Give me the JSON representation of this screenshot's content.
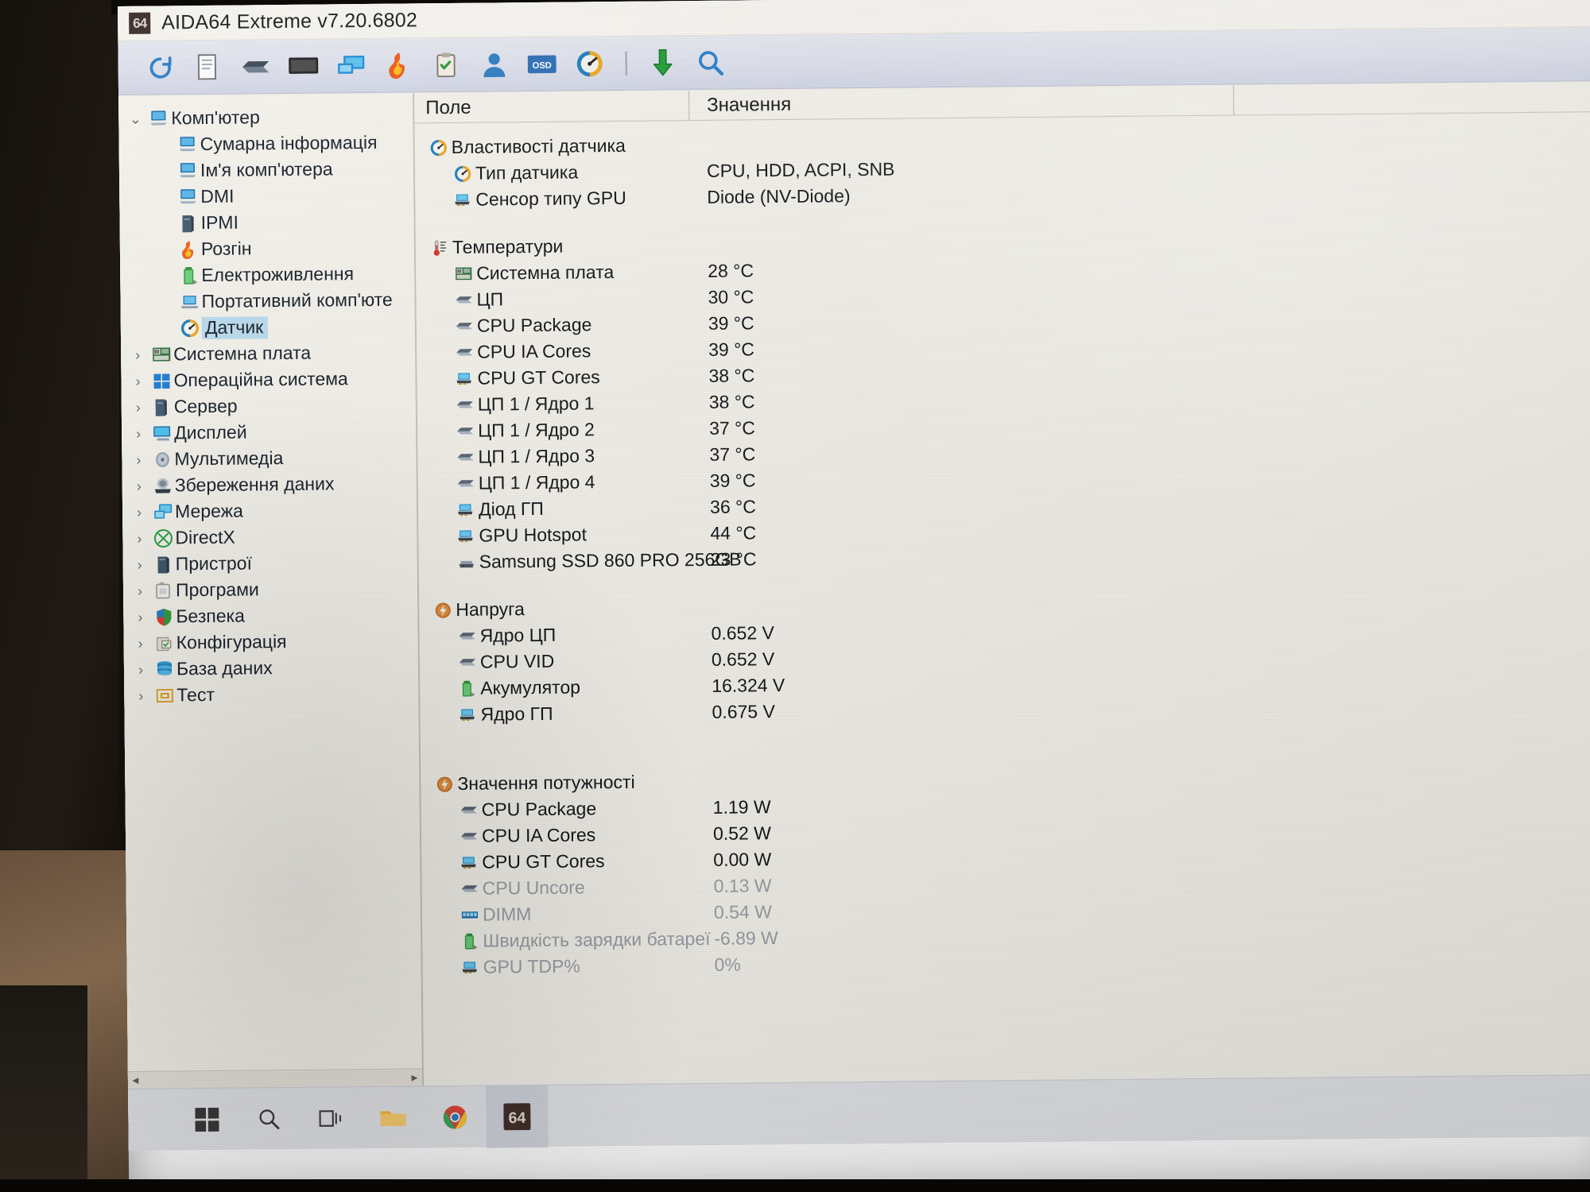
{
  "window": {
    "title": "AIDA64 Extreme v7.20.6802",
    "app_badge": "64"
  },
  "toolbar": {
    "buttons": [
      {
        "name": "refresh-icon",
        "tooltip": "Refresh"
      },
      {
        "name": "report-icon",
        "tooltip": "Report"
      },
      {
        "name": "motherboard-icon",
        "tooltip": "Motherboard"
      },
      {
        "name": "monitor-icon",
        "tooltip": "Display"
      },
      {
        "name": "network-icon",
        "tooltip": "Network"
      },
      {
        "name": "overclock-icon",
        "tooltip": "Overclock"
      },
      {
        "name": "benchmark-icon",
        "tooltip": "Benchmark"
      },
      {
        "name": "user-icon",
        "tooltip": "User"
      },
      {
        "name": "osd-icon",
        "tooltip": "OSD Panel"
      },
      {
        "name": "sensor-icon",
        "tooltip": "Sensor"
      },
      {
        "name": "download-icon",
        "tooltip": "Download"
      },
      {
        "name": "search-icon",
        "tooltip": "Search"
      }
    ],
    "osd_label": "OSD"
  },
  "sidebar": {
    "items": [
      {
        "label": "Комп'ютер",
        "depth": 0,
        "twisty": "open",
        "icon": "computer-icon",
        "selected": false
      },
      {
        "label": "Сумарна інформація",
        "depth": 1,
        "twisty": "none",
        "icon": "computer-icon",
        "selected": false
      },
      {
        "label": "Ім'я комп'ютера",
        "depth": 1,
        "twisty": "none",
        "icon": "computer-icon",
        "selected": false
      },
      {
        "label": "DMI",
        "depth": 1,
        "twisty": "none",
        "icon": "computer-icon",
        "selected": false
      },
      {
        "label": "IPMI",
        "depth": 1,
        "twisty": "none",
        "icon": "server-icon",
        "selected": false
      },
      {
        "label": "Розгін",
        "depth": 1,
        "twisty": "none",
        "icon": "flame-icon",
        "selected": false
      },
      {
        "label": "Електроживлення",
        "depth": 1,
        "twisty": "none",
        "icon": "battery-icon",
        "selected": false
      },
      {
        "label": "Портативний комп'юте",
        "depth": 1,
        "twisty": "none",
        "icon": "laptop-icon",
        "selected": false
      },
      {
        "label": "Датчик",
        "depth": 1,
        "twisty": "none",
        "icon": "gauge-icon",
        "selected": true
      },
      {
        "label": "Системна плата",
        "depth": 0,
        "twisty": "closed",
        "icon": "mainboard-icon",
        "selected": false
      },
      {
        "label": "Операційна система",
        "depth": 0,
        "twisty": "closed",
        "icon": "windows-icon",
        "selected": false
      },
      {
        "label": "Сервер",
        "depth": 0,
        "twisty": "closed",
        "icon": "server-icon",
        "selected": false
      },
      {
        "label": "Дисплей",
        "depth": 0,
        "twisty": "closed",
        "icon": "display-icon",
        "selected": false
      },
      {
        "label": "Мультимедіа",
        "depth": 0,
        "twisty": "closed",
        "icon": "multimedia-icon",
        "selected": false
      },
      {
        "label": "Збереження даних",
        "depth": 0,
        "twisty": "closed",
        "icon": "storage-icon",
        "selected": false
      },
      {
        "label": "Мережа",
        "depth": 0,
        "twisty": "closed",
        "icon": "network2-icon",
        "selected": false
      },
      {
        "label": "DirectX",
        "depth": 0,
        "twisty": "closed",
        "icon": "directx-icon",
        "selected": false
      },
      {
        "label": "Пристрої",
        "depth": 0,
        "twisty": "closed",
        "icon": "devices-icon",
        "selected": false
      },
      {
        "label": "Програми",
        "depth": 0,
        "twisty": "closed",
        "icon": "programs-icon",
        "selected": false
      },
      {
        "label": "Безпека",
        "depth": 0,
        "twisty": "closed",
        "icon": "shield-icon",
        "selected": false
      },
      {
        "label": "Конфігурація",
        "depth": 0,
        "twisty": "closed",
        "icon": "config-icon",
        "selected": false
      },
      {
        "label": "База даних",
        "depth": 0,
        "twisty": "closed",
        "icon": "database-icon",
        "selected": false
      },
      {
        "label": "Тест",
        "depth": 0,
        "twisty": "closed",
        "icon": "test-icon",
        "selected": false
      }
    ],
    "scroll_left_arrow": "◄",
    "scroll_right_arrow": "►"
  },
  "detail": {
    "columns": {
      "field": "Поле",
      "value": "Значення"
    },
    "rows": [
      {
        "type": "group",
        "icon": "gauge-icon",
        "name": "Властивості датчика",
        "value": ""
      },
      {
        "type": "item",
        "icon": "gauge-icon",
        "name": "Тип датчика",
        "value": "CPU, HDD, ACPI, SNB"
      },
      {
        "type": "item",
        "icon": "gpu-icon",
        "name": "Сенсор типу GPU",
        "value": "Diode  (NV-Diode)"
      },
      {
        "type": "spacer"
      },
      {
        "type": "group",
        "icon": "thermometer-icon",
        "name": "Температури",
        "value": ""
      },
      {
        "type": "item",
        "icon": "mainboard-icon",
        "name": "Системна плата",
        "value": "28 °C"
      },
      {
        "type": "item",
        "icon": "chip-icon",
        "name": "ЦП",
        "value": "30 °C"
      },
      {
        "type": "item",
        "icon": "chip-icon",
        "name": "CPU Package",
        "value": "39 °C"
      },
      {
        "type": "item",
        "icon": "chip-icon",
        "name": "CPU IA Cores",
        "value": "39 °C"
      },
      {
        "type": "item",
        "icon": "gpu-icon",
        "name": "CPU GT Cores",
        "value": "38 °C"
      },
      {
        "type": "item",
        "icon": "chip-icon",
        "name": "ЦП 1 / Ядро 1",
        "value": "38 °C"
      },
      {
        "type": "item",
        "icon": "chip-icon",
        "name": "ЦП 1 / Ядро 2",
        "value": "37 °C"
      },
      {
        "type": "item",
        "icon": "chip-icon",
        "name": "ЦП 1 / Ядро 3",
        "value": "37 °C"
      },
      {
        "type": "item",
        "icon": "chip-icon",
        "name": "ЦП 1 / Ядро 4",
        "value": "39 °C"
      },
      {
        "type": "item",
        "icon": "gpu-icon",
        "name": "Діод ГП",
        "value": "36 °C"
      },
      {
        "type": "item",
        "icon": "gpu-icon",
        "name": "GPU Hotspot",
        "value": "44 °C"
      },
      {
        "type": "item",
        "icon": "disk-icon",
        "name": "Samsung SSD 860 PRO 256GB",
        "value": "23 °C",
        "wide": true
      },
      {
        "type": "spacer"
      },
      {
        "type": "group",
        "icon": "voltage-icon",
        "name": "Напруга",
        "value": ""
      },
      {
        "type": "item",
        "icon": "chip-icon",
        "name": "Ядро ЦП",
        "value": "0.652 V"
      },
      {
        "type": "item",
        "icon": "chip-icon",
        "name": "CPU VID",
        "value": "0.652 V"
      },
      {
        "type": "item",
        "icon": "battery-icon",
        "name": "Акумулятор",
        "value": "16.324 V"
      },
      {
        "type": "item",
        "icon": "gpu-icon",
        "name": "Ядро ГП",
        "value": "0.675 V"
      },
      {
        "type": "spacer"
      },
      {
        "type": "spacer"
      },
      {
        "type": "group",
        "icon": "voltage-icon",
        "name": "Значення потужності",
        "value": ""
      },
      {
        "type": "item",
        "icon": "chip-icon",
        "name": "CPU Package",
        "value": "1.19 W"
      },
      {
        "type": "item",
        "icon": "chip-icon",
        "name": "CPU IA Cores",
        "value": "0.52 W"
      },
      {
        "type": "item",
        "icon": "gpu-icon",
        "name": "CPU GT Cores",
        "value": "0.00 W"
      },
      {
        "type": "item",
        "icon": "chip-icon",
        "name": "CPU Uncore",
        "value": "0.13 W",
        "dim": true
      },
      {
        "type": "item",
        "icon": "dimm-icon",
        "name": "DIMM",
        "value": "0.54 W",
        "dim": true
      },
      {
        "type": "item",
        "icon": "battery-icon",
        "name": "Швидкість зарядки батареї",
        "value": "-6.89 W",
        "dim": true,
        "wide": true
      },
      {
        "type": "item",
        "icon": "gpu-icon",
        "name": "GPU TDP%",
        "value": "0%",
        "dim": true
      }
    ]
  },
  "taskbar": {
    "items": [
      {
        "name": "start-button",
        "label": ""
      },
      {
        "name": "search-taskbar-icon",
        "label": ""
      },
      {
        "name": "task-view-icon",
        "label": ""
      },
      {
        "name": "file-explorer-icon",
        "label": ""
      },
      {
        "name": "chrome-icon",
        "label": ""
      },
      {
        "name": "aida64-taskbar-icon",
        "label": "64"
      }
    ]
  },
  "colors": {
    "selection": "#bcddf0",
    "toolbar_top": "#e6e8f0",
    "window_bg": "#f3f1ea"
  }
}
